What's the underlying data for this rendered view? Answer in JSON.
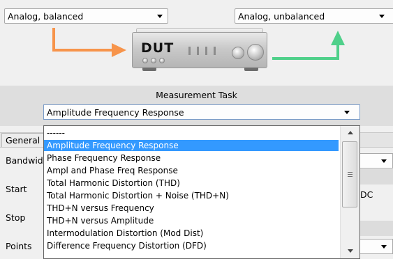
{
  "routing": {
    "input_select": {
      "value": "Analog, balanced"
    },
    "output_select": {
      "value": "Analog, unbalanced"
    },
    "device_label": "DUT",
    "colors": {
      "input_arrow": "#f7944b",
      "output_arrow": "#4fd08a"
    }
  },
  "measurement_task": {
    "title": "Measurement Task",
    "selected": "Amplitude Frequency Response",
    "options": [
      "------",
      "Amplitude Frequency Response",
      "Phase Frequency Response",
      "Ampl and Phase Freq Response",
      "Total Harmonic Distortion (THD)",
      "Total Harmonic Distortion + Noise (THD+N)",
      "THD+N versus Frequency",
      "THD+N versus Amplitude",
      "Intermodulation Distortion (Mod Dist)",
      "Difference Frequency Distortion (DFD)"
    ],
    "highlight_color": "#3399ff"
  },
  "background_form": {
    "tab_general": "General",
    "labels": {
      "bandwidth": "Bandwidth",
      "start": "Start",
      "stop": "Stop",
      "points": "Points"
    },
    "partial_value_dc": "DC"
  }
}
